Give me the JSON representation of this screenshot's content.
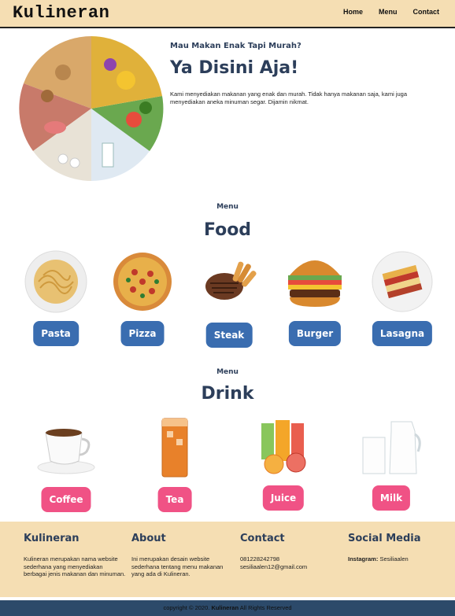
{
  "nav": {
    "brand": "Kulineran",
    "links": [
      "Home",
      "Menu",
      "Contact"
    ]
  },
  "hero": {
    "subtitle": "Mau Makan Enak Tapi Murah?",
    "title": "Ya Disini Aja!",
    "text": "Kami menyediakan makanan yang enak dan murah. Tidak hanya makanan saja, kami juga menyediakan aneka minuman segar. Dijamin nikmat.",
    "image": "healthy-food-circle-image"
  },
  "food": {
    "label": "Menu",
    "title": "Food",
    "items": [
      "Pasta",
      "Pizza",
      "Steak",
      "Burger",
      "Lasagna"
    ]
  },
  "drink": {
    "label": "Menu",
    "title": "Drink",
    "items": [
      "Coffee",
      "Tea",
      "Juice",
      "Milk"
    ]
  },
  "footer": {
    "brand": {
      "title": "Kulineran",
      "text": "Kulineran merupakan nama website sederhana yang menyediakan berbagai jenis makanan dan minuman."
    },
    "about": {
      "title": "About",
      "text": "Ini merupakan desain website sederhana tentang menu makanan yang ada di Kulineran."
    },
    "contact": {
      "title": "Contact",
      "phone": "081228242798",
      "email": "sesiliaalen12@gmail.com"
    },
    "social": {
      "title": "Social Media",
      "label": "Instagram:",
      "handle": "Sesiliaalen"
    },
    "copyright_prefix": "copyright © 2020.",
    "copyright_brand": "Kulineran",
    "copyright_suffix": "All Rights Reserved"
  },
  "colors": {
    "nav_bg": "#f5deb3",
    "heading": "#2c3e5a",
    "food_button": "#3a6db0",
    "drink_button": "#f05285",
    "copyright_bar": "#2c4a6a"
  }
}
